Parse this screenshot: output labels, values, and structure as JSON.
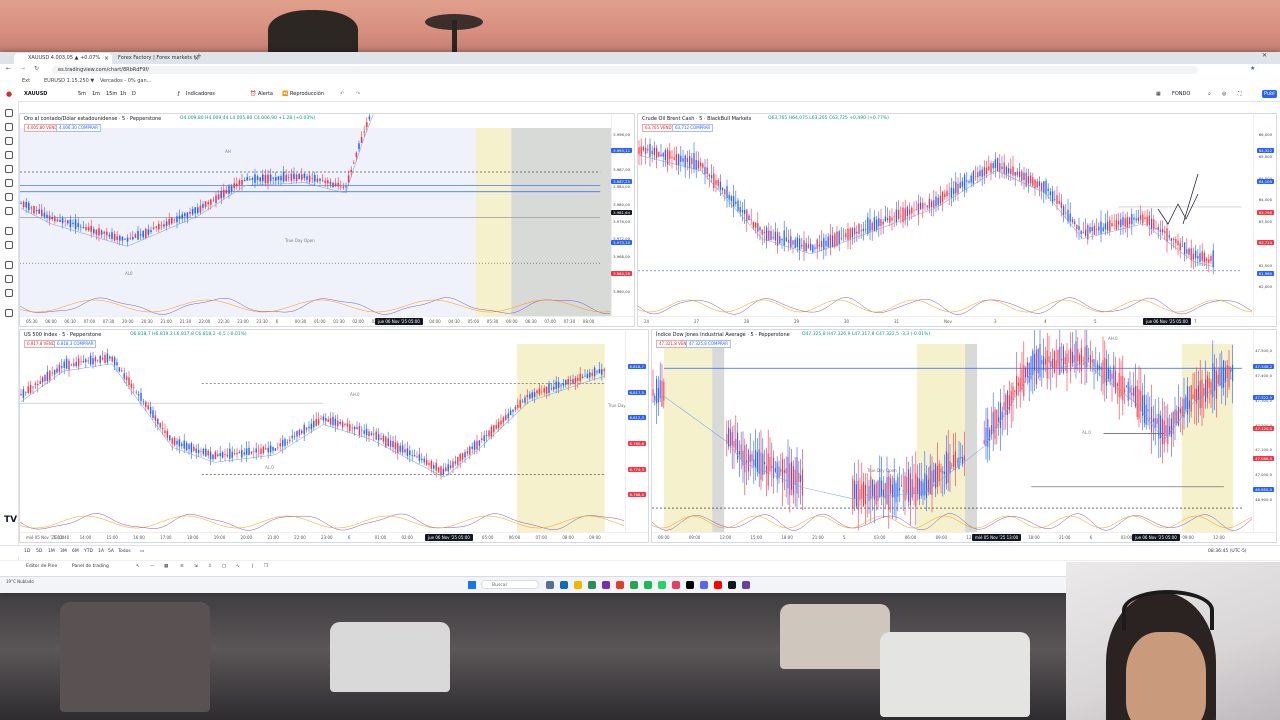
{
  "browser": {
    "tabs": [
      {
        "label": "XAUUSD 4.003,05 ▲ +0.07% ",
        "active": true
      },
      {
        "label": "Forex Factory | Forex markets f...",
        "active": false
      }
    ],
    "new_tab": "+",
    "url": "es.tradingview.com/chart/8RbRdF9f/",
    "bookmarks": [
      "Ext",
      "EURUSD 1.15.250 ▼",
      "Vercados - 0% gan..."
    ]
  },
  "tv_toolbar": {
    "symbol": "XAUUSD",
    "intervals": [
      "5m",
      "1m",
      "15m",
      "1h",
      "D"
    ],
    "indicators": "Indicadores",
    "alert": "Alerta",
    "replay": "Reproducción",
    "right_label": "FONDO",
    "publish": "Publ"
  },
  "panes": {
    "top_left": {
      "title": "Oro al contado/Dólar estadounidense · 5 · Pepperstone",
      "stats": "O4.009,80 H4.009,44 L4.005,80 C4.006,90 +1.28 (+0.03%)",
      "badge_sell": "4.005,80 VENDER",
      "badge_buy": "4.006,30 COMPRAR",
      "annotation_main": "True Day Open",
      "annotation_low": "AL0",
      "annotation_high": "AH",
      "cursor_time": "jue 06 Nov '25 05:00",
      "time_ticks": [
        "05:30",
        "06:00",
        "06:30",
        "07:00",
        "07:30",
        "20:00",
        "20:30",
        "21:00",
        "21:30",
        "22:00",
        "22:30",
        "23:00",
        "23:30",
        "6",
        "00:30",
        "01:00",
        "01:30",
        "02:00",
        "02:30",
        "03:00",
        "03:30",
        "04:00",
        "04:30",
        "05:00",
        "05:30",
        "06:00",
        "06:30",
        "07:00",
        "07:30",
        "08:00"
      ],
      "prices": [
        "3.996,00",
        "3.992,00",
        "3.987,00",
        "3.984,00",
        "3.980,00",
        "3.976,00",
        "3.972,00",
        "3.968,00",
        "3.964,00",
        "3.960,00"
      ],
      "price_labels": [
        {
          "text": "3.993,11",
          "kind": "blue"
        },
        {
          "text": "3.987,25",
          "kind": "blue"
        },
        {
          "text": "3.981,64",
          "kind": "dark"
        },
        {
          "text": "3.973,10",
          "kind": "blue"
        },
        {
          "text": "3.964,28",
          "kind": "red"
        }
      ]
    },
    "top_right": {
      "title": "Crude Oil Brent Cash · 5 · BlackBull Markets",
      "stats": "O63,765 H64,075 L63,205 C63,725 +0,490 (+0.77%)",
      "badge_sell": "63,705 VENDER",
      "badge_buy": "63,712 COMPRAR",
      "cursor_time": "jue 06 Nov '25 05:00",
      "time_ticks": [
        "24",
        "27",
        "28",
        "29",
        "30",
        "31",
        "Nov",
        "3",
        "4",
        "5",
        "6",
        "7"
      ],
      "prices": [
        "66,000",
        "65,000",
        "64,500",
        "64,000",
        "63,500",
        "63,000",
        "62,500",
        "62,000"
      ],
      "price_labels": [
        {
          "text": "64,322",
          "kind": "blue"
        },
        {
          "text": "64,105",
          "kind": "blue"
        },
        {
          "text": "63,798",
          "kind": "red"
        },
        {
          "text": "63,710",
          "kind": "red"
        },
        {
          "text": "61,980",
          "kind": "blue"
        }
      ]
    },
    "bottom_left": {
      "title": "US 500 Index · 5 · Pepperstone",
      "stats": "O6.818,7 H6.819,2 L6.817,8 C6.818,2 -0,5 (-0.01%)",
      "badge_sell": "6.817,8 VENDER",
      "badge_buy": "6.818,3 COMPRAR",
      "annotation_main": "True Day",
      "annotation_low": "AL.0",
      "annotation_high": "AH.0",
      "cursor_time": "jue 06 Nov '25 05:00",
      "time_ticks": [
        "mié 05 Nov '25 11:40",
        "13:00",
        "14:00",
        "15:00",
        "16:00",
        "17:00",
        "18:00",
        "19:00",
        "20:00",
        "21:00",
        "22:00",
        "23:00",
        "6",
        "01:00",
        "02:00",
        "03:00",
        "04:00",
        "05:00",
        "06:00",
        "07:00",
        "08:00",
        "09:00"
      ],
      "price_labels": [
        {
          "text": "6.818,7",
          "kind": "blue"
        },
        {
          "text": "6.817,5",
          "kind": "blue"
        },
        {
          "text": "6.812,3",
          "kind": "blue"
        },
        {
          "text": "6.780,8",
          "kind": "red"
        },
        {
          "text": "6.774,3",
          "kind": "red"
        },
        {
          "text": "6.768,0",
          "kind": "red"
        }
      ]
    },
    "bottom_right": {
      "title": "Índice Dow Jones Industrial Average · 5 · Pepperstone",
      "stats": "O47.325,8 H47.326,9 L47.317,8 C47.322,5 -3,3 (-0.01%)",
      "badge_sell": "47.321,8 VENDER",
      "badge_buy": "47.325,8 COMPRAR",
      "annotation_main": "True Day Open",
      "annotation_low": "AL.0",
      "annotation_high": "AH.0",
      "cursor_time_a": "mié 05 Nov '25 13:00",
      "cursor_time_b": "jue 06 Nov '25 05:00",
      "time_ticks": [
        "06:00",
        "09:00",
        "12:00",
        "15:00",
        "18:00",
        "21:00",
        "5",
        "03:00",
        "06:00",
        "09:00",
        "12:00",
        "15:00",
        "18:00",
        "21:00",
        "6",
        "03:00",
        "06:00",
        "09:00",
        "12:00"
      ],
      "prices": [
        "47.500,0",
        "47.400,0",
        "47.300,0",
        "47.200,0",
        "47.100,0",
        "47.000,0",
        "46.900,0"
      ],
      "price_labels": [
        {
          "text": "47.348,2",
          "kind": "blue"
        },
        {
          "text": "47.322,5",
          "kind": "blue"
        },
        {
          "text": "47.120,0",
          "kind": "red"
        },
        {
          "text": "47.088,5",
          "kind": "red"
        },
        {
          "text": "46.950,0",
          "kind": "blue"
        }
      ]
    }
  },
  "bottom_panel": {
    "ranges": [
      "1D",
      "5D",
      "1M",
      "3M",
      "6M",
      "YTD",
      "1A",
      "5A",
      "Todos"
    ],
    "time_label": "08:36:45 (UTC-5)",
    "tabs": [
      "Editor de Pine",
      "Panel de trading"
    ]
  },
  "taskbar": {
    "search_placeholder": "Buscar",
    "weather": "19°C Nublado"
  },
  "colors": {
    "up": "#2962ff",
    "down": "#f23645",
    "highlight_yellow": "#f1ebb8",
    "highlight_grey": "#c8cbc6",
    "ma_line": "#6a9ee8"
  }
}
